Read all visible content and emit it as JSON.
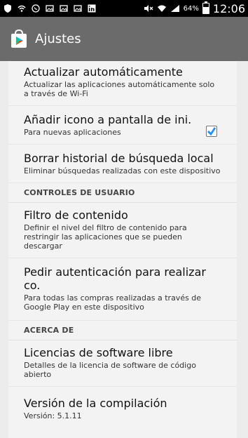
{
  "status_bar": {
    "battery": "64%",
    "time": "12:06",
    "icons": [
      "shield-icon",
      "wifi-icon",
      "whatsapp-icon",
      "gallery-icon",
      "gallery-icon",
      "gallery-icon",
      "linkedin-icon",
      "mute-icon",
      "wifi-signal-icon",
      "cell-signal-icon",
      "battery-icon"
    ]
  },
  "action_bar": {
    "title": "Ajustes"
  },
  "settings": [
    {
      "type": "item",
      "title": "Actualizar automáticamente",
      "subtitle": "Actualizar las aplicaciones automáticamente solo a través de Wi-Fi"
    },
    {
      "type": "item",
      "title": "Añadir icono a pantalla de ini.",
      "subtitle": "Para nuevas aplicaciones",
      "checkbox": true
    },
    {
      "type": "item",
      "title": "Borrar historial de búsqueda local",
      "subtitle": "Eliminar búsquedas realizadas con este dispositivo"
    },
    {
      "type": "section",
      "title": "CONTROLES DE USUARIO"
    },
    {
      "type": "item",
      "title": "Filtro de contenido",
      "subtitle": "Definir el nivel del filtro de contenido para restringir las aplicaciones que se pueden descargar"
    },
    {
      "type": "item",
      "title": "Pedir autenticación para realizar co.",
      "subtitle": "Para todas las compras realizadas a través de Google Play en este dispositivo"
    },
    {
      "type": "section",
      "title": "ACERCA DE"
    },
    {
      "type": "item",
      "title": "Licencias de software libre",
      "subtitle": "Detalles de la licencia de software de código abierto"
    },
    {
      "type": "item",
      "title": "Versión de la compilación",
      "subtitle": "Versión: 5.1.11"
    }
  ],
  "colors": {
    "action_bar": "#6b6b6b",
    "check": "#1e90ff"
  }
}
